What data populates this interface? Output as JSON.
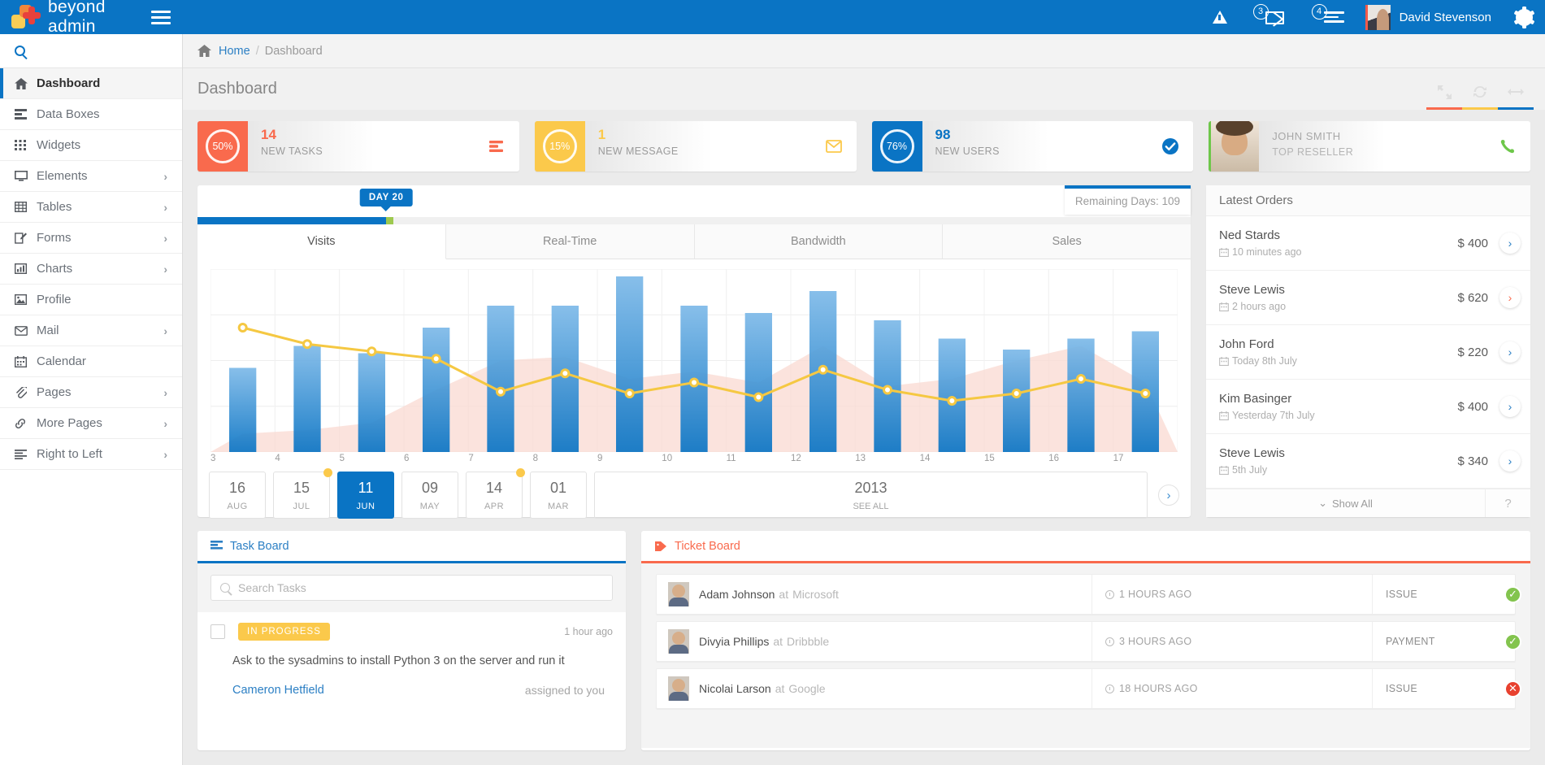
{
  "brand": {
    "name": "beyond admin"
  },
  "topbar": {
    "warning_icon": "warning-triangle-icon",
    "messages_badge": "3",
    "tasks_badge": "4",
    "user_name": "David Stevenson",
    "settings_icon": "gear-icon"
  },
  "sidebar": {
    "search_placeholder": "",
    "items": [
      {
        "label": "Dashboard",
        "icon": "home-icon",
        "active": true,
        "chevron": false
      },
      {
        "label": "Data Boxes",
        "icon": "databox-icon",
        "active": false,
        "chevron": false
      },
      {
        "label": "Widgets",
        "icon": "grid-icon",
        "active": false,
        "chevron": false
      },
      {
        "label": "Elements",
        "icon": "monitor-icon",
        "active": false,
        "chevron": true
      },
      {
        "label": "Tables",
        "icon": "table-icon",
        "active": false,
        "chevron": true
      },
      {
        "label": "Forms",
        "icon": "edit-icon",
        "active": false,
        "chevron": true
      },
      {
        "label": "Charts",
        "icon": "barchart-icon",
        "active": false,
        "chevron": true
      },
      {
        "label": "Profile",
        "icon": "image-icon",
        "active": false,
        "chevron": false
      },
      {
        "label": "Mail",
        "icon": "envelope-icon",
        "active": false,
        "chevron": true
      },
      {
        "label": "Calendar",
        "icon": "calendar-icon",
        "active": false,
        "chevron": false
      },
      {
        "label": "Pages",
        "icon": "paperclip-icon",
        "active": false,
        "chevron": true
      },
      {
        "label": "More Pages",
        "icon": "link-icon",
        "active": false,
        "chevron": true
      },
      {
        "label": "Right to Left",
        "icon": "align-icon",
        "active": false,
        "chevron": true
      }
    ]
  },
  "breadcrumb": {
    "home": "Home",
    "separator": "/",
    "current": "Dashboard"
  },
  "page": {
    "title": "Dashboard",
    "tools": [
      "expand-icon",
      "refresh-icon",
      "resize-icon"
    ],
    "tool_colors": [
      "#f96a4d",
      "#fbc94b",
      "#0a74c4"
    ]
  },
  "stats": [
    {
      "percent": "50%",
      "value": "14",
      "label": "NEW TASKS",
      "color": "red",
      "icon": "server-icon"
    },
    {
      "percent": "15%",
      "value": "1",
      "label": "NEW MESSAGE",
      "color": "yellow",
      "icon": "envelope-icon"
    },
    {
      "percent": "76%",
      "value": "98",
      "label": "NEW USERS",
      "color": "blue",
      "icon": "check-circle-icon"
    }
  ],
  "reseller": {
    "name": "JOHN SMITH",
    "role": "TOP RESELLER",
    "icon": "phone-icon"
  },
  "chart_panel": {
    "day_pill": "DAY 20",
    "tooltip": "Remaining Days: 109",
    "progress_percent": 19,
    "tabs": [
      {
        "label": "Visits",
        "active": true
      },
      {
        "label": "Real-Time",
        "active": false
      },
      {
        "label": "Bandwidth",
        "active": false
      },
      {
        "label": "Sales",
        "active": false
      }
    ],
    "dates": [
      {
        "day": "16",
        "month": "AUG",
        "selected": false,
        "dot": false
      },
      {
        "day": "15",
        "month": "JUL",
        "selected": false,
        "dot": true
      },
      {
        "day": "11",
        "month": "JUN",
        "selected": true,
        "dot": false
      },
      {
        "day": "09",
        "month": "MAY",
        "selected": false,
        "dot": false
      },
      {
        "day": "14",
        "month": "APR",
        "selected": false,
        "dot": true
      },
      {
        "day": "01",
        "month": "MAR",
        "selected": false,
        "dot": false
      }
    ],
    "see_all": {
      "year": "2013",
      "label": "SEE ALL"
    },
    "next_icon": "chevron-right-icon"
  },
  "chart_data": {
    "type": "bar",
    "title": "Visits",
    "xlabel": "",
    "ylabel": "",
    "grid": true,
    "legend": "none",
    "categories": [
      "3",
      "4",
      "5",
      "6",
      "7",
      "8",
      "9",
      "10",
      "11",
      "12",
      "13",
      "14",
      "15",
      "16",
      "17"
    ],
    "ylim": [
      0,
      100
    ],
    "series": [
      {
        "name": "Visits",
        "type": "bar",
        "color": "#1f7fd0",
        "values": [
          46,
          58,
          54,
          68,
          80,
          80,
          96,
          80,
          76,
          88,
          72,
          62,
          56,
          62,
          66
        ]
      },
      {
        "name": "Trend",
        "type": "line",
        "color": "#f5c842",
        "values": [
          68,
          59,
          55,
          51,
          33,
          43,
          32,
          38,
          30,
          45,
          34,
          28,
          32,
          40,
          32
        ]
      },
      {
        "name": "Baseline",
        "type": "area",
        "color": "#f9d9d2",
        "values": [
          10,
          12,
          16,
          34,
          50,
          52,
          40,
          44,
          38,
          58,
          36,
          40,
          50,
          58,
          38
        ]
      }
    ]
  },
  "orders": {
    "title": "Latest Orders",
    "rows": [
      {
        "name": "Ned Stards",
        "when": "10 minutes ago",
        "amount": "$ 400",
        "arrow_color": "blue"
      },
      {
        "name": "Steve Lewis",
        "when": "2 hours ago",
        "amount": "$ 620",
        "arrow_color": "red"
      },
      {
        "name": "John Ford",
        "when": "Today 8th July",
        "amount": "$ 220",
        "arrow_color": "blue"
      },
      {
        "name": "Kim Basinger",
        "when": "Yesterday 7th July",
        "amount": "$ 400",
        "arrow_color": "blue"
      },
      {
        "name": "Steve Lewis",
        "when": "5th July",
        "amount": "$ 340",
        "arrow_color": "blue"
      }
    ],
    "show_all": "Show All",
    "help": "?"
  },
  "task_board": {
    "title": "Task Board",
    "icon": "list-icon",
    "search_placeholder": "Search Tasks",
    "tasks": [
      {
        "status": "IN PROGRESS",
        "when": "1 hour ago",
        "text": "Ask to the sysadmins to install Python 3 on the server and run it",
        "user": "Cameron Hetfield",
        "assigned": "assigned to you"
      }
    ]
  },
  "ticket_board": {
    "title": "Ticket Board",
    "icon": "tag-icon",
    "rows": [
      {
        "name": "Adam Johnson",
        "at": "at",
        "org": "Microsoft",
        "time": "1 HOURS AGO",
        "type": "ISSUE",
        "status": "ok"
      },
      {
        "name": "Divyia Phillips",
        "at": "at",
        "org": "Dribbble",
        "time": "3 HOURS AGO",
        "type": "PAYMENT",
        "status": "ok"
      },
      {
        "name": "Nicolai Larson",
        "at": "at",
        "org": "Google",
        "time": "18 HOURS AGO",
        "type": "ISSUE",
        "status": "no"
      }
    ]
  }
}
